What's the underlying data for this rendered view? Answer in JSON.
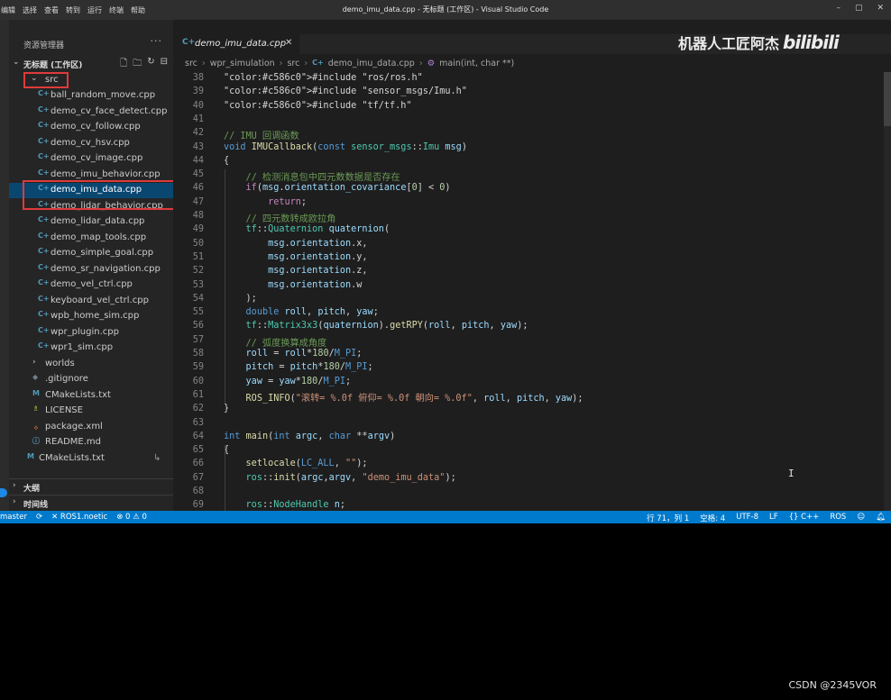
{
  "window": {
    "title": "demo_imu_data.cpp - 无标题 (工作区) - Visual Studio Code",
    "menu": [
      "编辑",
      "选择",
      "查看",
      "转到",
      "运行",
      "终端",
      "帮助"
    ],
    "controls": [
      "–",
      "▢",
      "✕"
    ]
  },
  "sidebar": {
    "title": "资源管理器",
    "more": "···",
    "workspace": "无标题 (工作区)",
    "src_folder": "src",
    "src_files": [
      "ball_random_move.cpp",
      "demo_cv_face_detect.cpp",
      "demo_cv_follow.cpp",
      "demo_cv_hsv.cpp",
      "demo_cv_image.cpp",
      "demo_imu_behavior.cpp",
      "demo_imu_data.cpp",
      "demo_lidar_behavior.cpp",
      "demo_lidar_data.cpp",
      "demo_map_tools.cpp",
      "demo_simple_goal.cpp",
      "demo_sr_navigation.cpp",
      "demo_vel_ctrl.cpp",
      "keyboard_vel_ctrl.cpp",
      "wpb_home_sim.cpp",
      "wpr_plugin.cpp",
      "wpr1_sim.cpp"
    ],
    "worlds": "worlds",
    "gitignore": ".gitignore",
    "cmakelists": "CMakeLists.txt",
    "license": "LICENSE",
    "package_xml": "package.xml",
    "readme": "README.md",
    "root_cmakelists": "CMakeLists.txt",
    "root_cmakelists_badge": "↳",
    "outline": "大纲",
    "timeline": "时间线"
  },
  "editor": {
    "tab_label": "demo_imu_data.cpp",
    "watermark": "机器人工匠阿杰",
    "watermark_logo": "bilibili",
    "breadcrumbs": [
      "src",
      "wpr_simulation",
      "src",
      "demo_imu_data.cpp",
      "main(int, char **)"
    ],
    "code_lines": [
      {
        "n": "38",
        "t": "#include \"ros/ros.h\""
      },
      {
        "n": "39",
        "t": "#include \"sensor_msgs/Imu.h\""
      },
      {
        "n": "40",
        "t": "#include \"tf/tf.h\""
      },
      {
        "n": "41",
        "t": ""
      },
      {
        "n": "42",
        "t": "// IMU 回调函数"
      },
      {
        "n": "43",
        "t": "void IMUCallback(const sensor_msgs::Imu msg)"
      },
      {
        "n": "44",
        "t": "{"
      },
      {
        "n": "45",
        "t": "    // 检测消息包中四元数数据是否存在"
      },
      {
        "n": "46",
        "t": "    if(msg.orientation_covariance[0] < 0)"
      },
      {
        "n": "47",
        "t": "        return;"
      },
      {
        "n": "48",
        "t": "    // 四元数转成欧拉角"
      },
      {
        "n": "49",
        "t": "    tf::Quaternion quaternion("
      },
      {
        "n": "50",
        "t": "        msg.orientation.x,"
      },
      {
        "n": "51",
        "t": "        msg.orientation.y,"
      },
      {
        "n": "52",
        "t": "        msg.orientation.z,"
      },
      {
        "n": "53",
        "t": "        msg.orientation.w"
      },
      {
        "n": "54",
        "t": "    );"
      },
      {
        "n": "55",
        "t": "    double roll, pitch, yaw;"
      },
      {
        "n": "56",
        "t": "    tf::Matrix3x3(quaternion).getRPY(roll, pitch, yaw);"
      },
      {
        "n": "57",
        "t": "    // 弧度换算成角度"
      },
      {
        "n": "58",
        "t": "    roll = roll*180/M_PI;"
      },
      {
        "n": "59",
        "t": "    pitch = pitch*180/M_PI;"
      },
      {
        "n": "60",
        "t": "    yaw = yaw*180/M_PI;"
      },
      {
        "n": "61",
        "t": "    ROS_INFO(\"滚转= %.0f 俯仰= %.0f 朝向= %.0f\", roll, pitch, yaw);"
      },
      {
        "n": "62",
        "t": "}"
      },
      {
        "n": "63",
        "t": ""
      },
      {
        "n": "64",
        "t": "int main(int argc, char **argv)"
      },
      {
        "n": "65",
        "t": "{"
      },
      {
        "n": "66",
        "t": "    setlocale(LC_ALL, \"\");"
      },
      {
        "n": "67",
        "t": "    ros::init(argc,argv, \"demo_imu_data\");"
      },
      {
        "n": "68",
        "t": ""
      },
      {
        "n": "69",
        "t": "    ros::NodeHandle n;"
      }
    ]
  },
  "status": {
    "branch": "master",
    "sync": "⟳",
    "ros": "✕ ROS1.noetic",
    "problems": "⊗ 0 ⚠ 0",
    "position": "行 71，列 1",
    "spaces": "空格: 4",
    "encoding": "UTF-8",
    "eol": "LF",
    "language": "{} C++",
    "ros_right": "ROS"
  },
  "credit": "CSDN @2345VOR"
}
